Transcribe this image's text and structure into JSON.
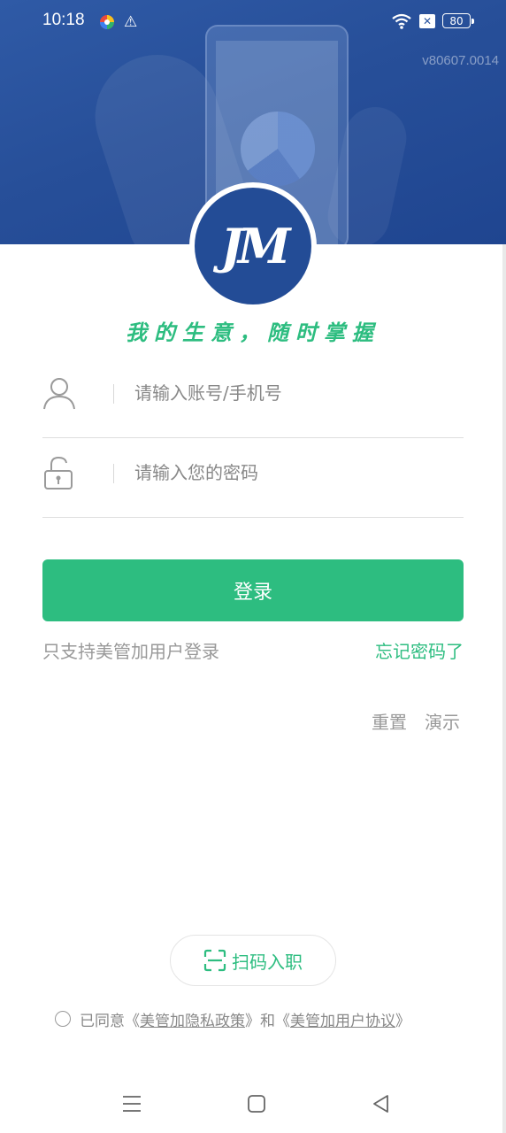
{
  "status_bar": {
    "time": "10:18",
    "battery": "80",
    "x_icon": "✕"
  },
  "header": {
    "version": "v80607.0014",
    "logo_text": "JM"
  },
  "slogan": "我的生意，随时掌握",
  "login_form": {
    "account_placeholder": "请输入账号/手机号",
    "password_placeholder": "请输入您的密码",
    "login_label": "登录",
    "hint": "只支持美管加用户登录",
    "forgot_label": "忘记密码了"
  },
  "extra_actions": {
    "reset_label": "重置",
    "demo_label": "演示"
  },
  "scan": {
    "label": "扫码入职"
  },
  "agreement": {
    "prefix": "已同意《",
    "privacy_link": "美管加隐私政策",
    "middle": "》和《",
    "user_link": "美管加用户协议",
    "suffix": "》"
  },
  "icons": {
    "account": "user-icon",
    "password": "lock-icon",
    "scan": "scan-icon",
    "nav_menu": "menu-icon",
    "nav_home": "home-icon",
    "nav_back": "back-icon"
  },
  "colors": {
    "brand_green": "#2dbd80",
    "header_blue": "#2b55a0"
  }
}
